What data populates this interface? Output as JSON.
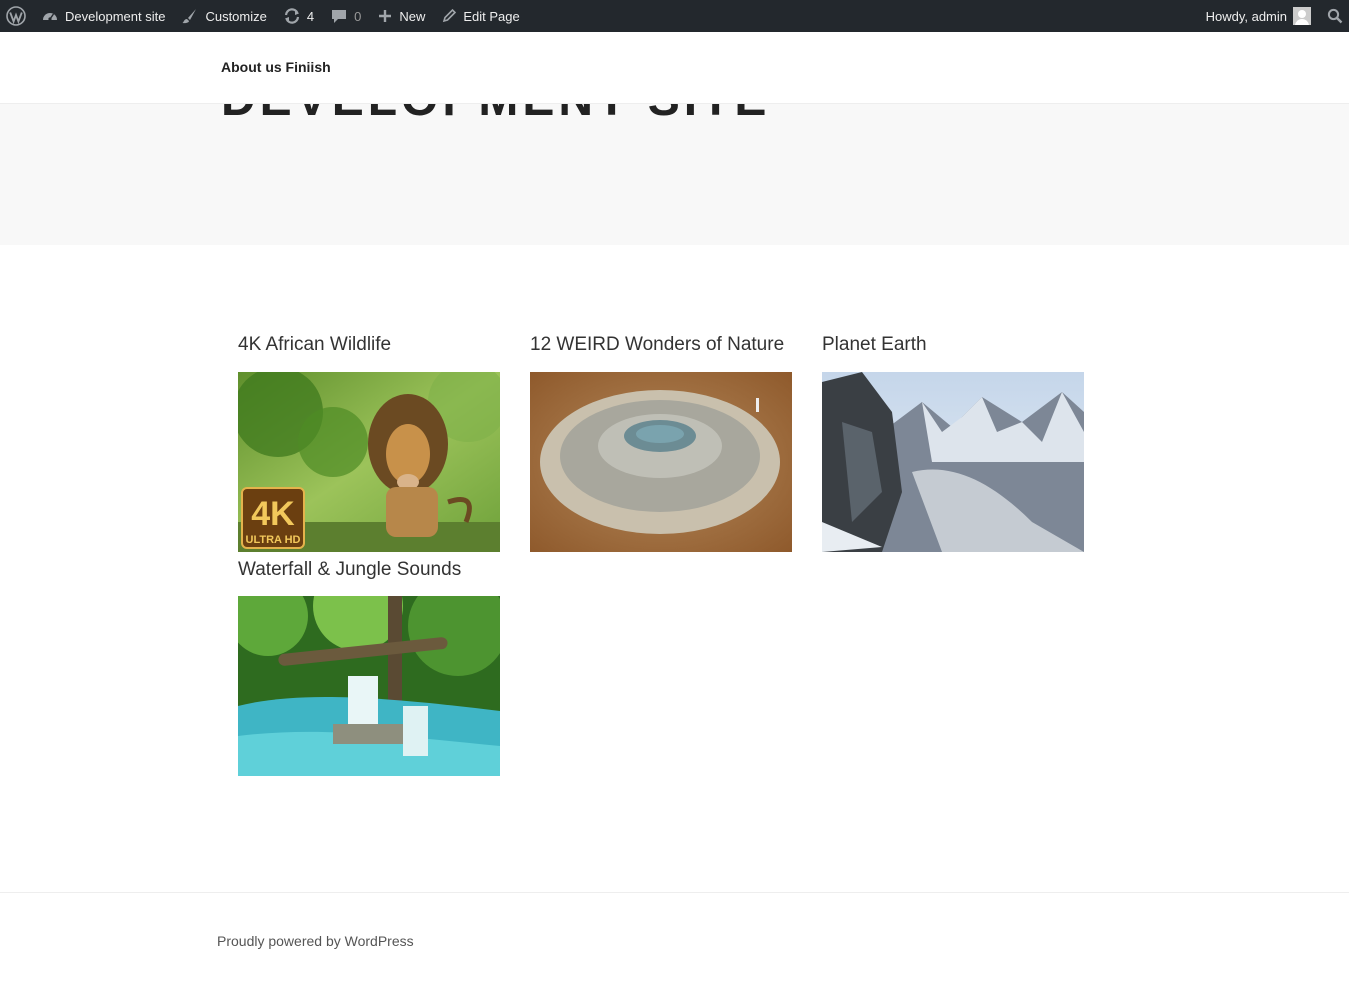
{
  "adminbar": {
    "logo_icon": "wordpress-logo-icon",
    "site_name": "Development site",
    "customize": "Customize",
    "updates_count": "4",
    "comments_count": "0",
    "new_label": "New",
    "edit_label": "Edit Page",
    "greeting": "Howdy, admin"
  },
  "nav": {
    "link": "About us Finiish"
  },
  "header": {
    "site_title": "Development site"
  },
  "gallery": {
    "items": [
      {
        "title": "4K African Wildlife",
        "badge_main": "4K",
        "badge_sub": "ULTRA HD"
      },
      {
        "title": "12 WEIRD Wonders of Nature"
      },
      {
        "title": "Planet Earth"
      },
      {
        "title": "Waterfall & Jungle Sounds"
      }
    ]
  },
  "footer": {
    "credit": "Proudly powered by WordPress"
  },
  "colors": {
    "adminbar_bg": "#23282d",
    "header_bg": "#f8f8f8",
    "text": "#222222"
  }
}
